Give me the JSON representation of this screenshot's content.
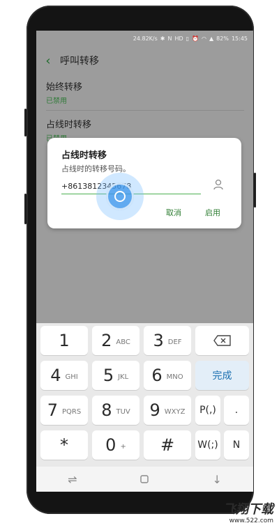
{
  "status_bar": {
    "speed": "24.82K/s",
    "icons": [
      "bluetooth-icon",
      "nfc-icon",
      "hd-icon",
      "vibrate-icon",
      "alarm-icon",
      "wifi-icon",
      "signal-icon"
    ],
    "battery": "82%",
    "time": "15:45"
  },
  "app_bar": {
    "title": "呼叫转移",
    "back_icon": "chevron-left-icon"
  },
  "list": [
    {
      "title": "始终转移",
      "subtitle": "已禁用"
    },
    {
      "title": "占线时转移",
      "subtitle": "已禁用"
    }
  ],
  "dialog": {
    "title": "占线时转移",
    "description": "占线时的转移号码。",
    "input_value": "+8613812345678",
    "contact_icon": "person-icon",
    "cancel_label": "取消",
    "enable_label": "启用"
  },
  "keypad": {
    "rows": [
      [
        {
          "digit": "1",
          "letters": ""
        },
        {
          "digit": "2",
          "letters": "ABC"
        },
        {
          "digit": "3",
          "letters": "DEF"
        }
      ],
      [
        {
          "digit": "4",
          "letters": "GHI"
        },
        {
          "digit": "5",
          "letters": "JKL"
        },
        {
          "digit": "6",
          "letters": "MNO"
        }
      ],
      [
        {
          "digit": "7",
          "letters": "PQRS"
        },
        {
          "digit": "8",
          "letters": "TUV"
        },
        {
          "digit": "9",
          "letters": "WXYZ"
        }
      ],
      [
        {
          "digit": "*",
          "letters": ""
        },
        {
          "digit": "0",
          "letters": "+"
        },
        {
          "digit": "#",
          "letters": ""
        }
      ]
    ],
    "side": {
      "backspace_icon": "backspace-icon",
      "done": "完成",
      "pause": "P(,)",
      "dot": ".",
      "wait": "W(;)",
      "n": "N"
    }
  },
  "nav_bar": {
    "icons": [
      "recent-apps-icon",
      "home-icon",
      "back-icon"
    ]
  },
  "watermark": {
    "brand": "飞翔下载",
    "url": "www.522.com"
  },
  "colors": {
    "accent_green": "#2e7d32",
    "overlay_gray": "#9c9c9c",
    "done_blue": "#1a6fb0"
  }
}
